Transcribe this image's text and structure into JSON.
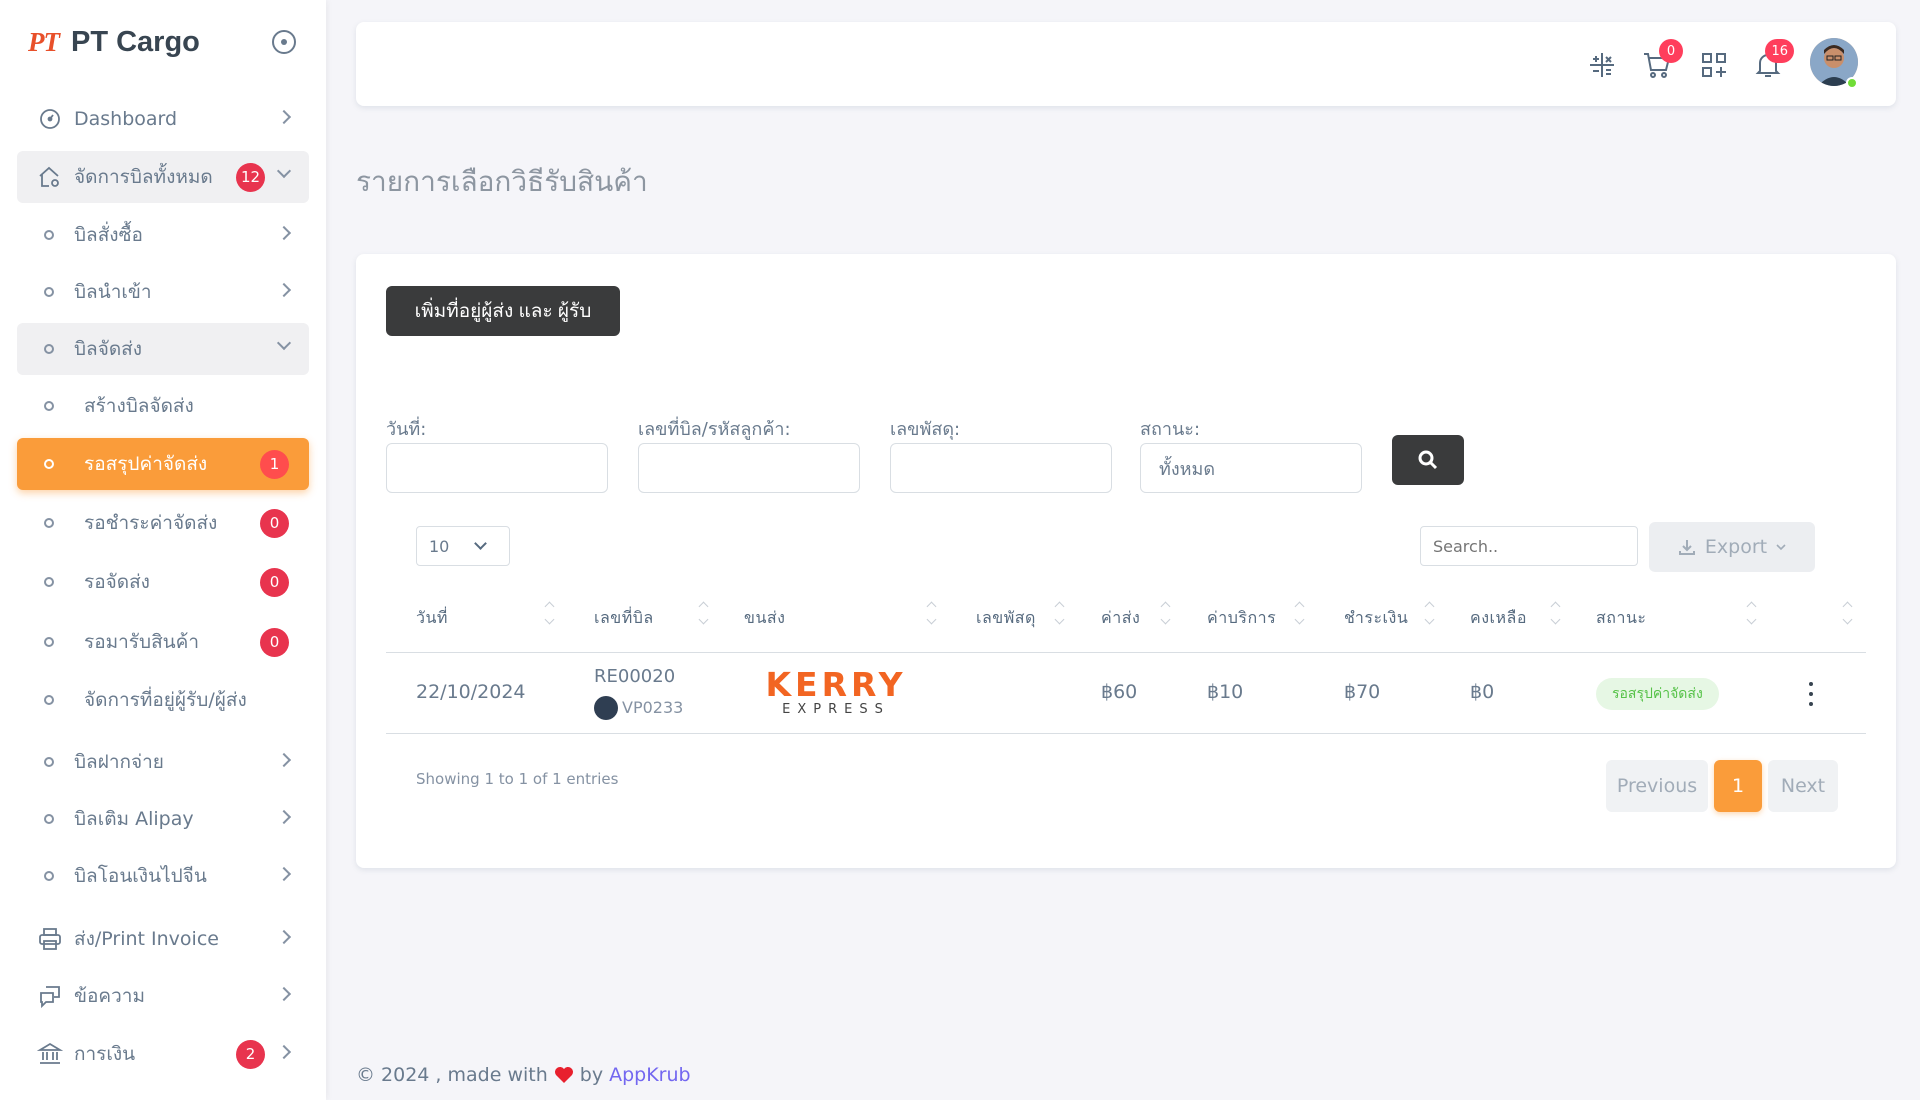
{
  "brand": {
    "logo": "PT",
    "name": "PT Cargo"
  },
  "sidebar": {
    "items": [
      {
        "label": "Dashboard"
      },
      {
        "label": "จัดการบิลทั้งหมด",
        "badge": "12"
      },
      {
        "label": "บิลสั่งซื้อ"
      },
      {
        "label": "บิลนำเข้า"
      },
      {
        "label": "บิลจัดส่ง"
      },
      {
        "label": "สร้างบิลจัดส่ง"
      },
      {
        "label": "รอสรุปค่าจัดส่ง",
        "badge": "1"
      },
      {
        "label": "รอชำระค่าจัดส่ง",
        "badge": "0"
      },
      {
        "label": "รอจัดส่ง",
        "badge": "0"
      },
      {
        "label": "รอมารับสินค้า",
        "badge": "0"
      },
      {
        "label": "จัดการที่อยู่ผู้รับ/ผู้ส่ง"
      },
      {
        "label": "บิลฝากจ่าย"
      },
      {
        "label": "บิลเติม Alipay"
      },
      {
        "label": "บิลโอนเงินไปจีน"
      },
      {
        "label": "ส่ง/Print Invoice"
      },
      {
        "label": "ข้อความ"
      },
      {
        "label": "การเงิน",
        "badge": "2"
      }
    ]
  },
  "topbar": {
    "cart_count": "0",
    "notification_count": "16"
  },
  "page": {
    "title": "รายการเลือกวิธีรับสินค้า"
  },
  "card": {
    "add_button": "เพิ่มที่อยู่ผู้ส่ง และ ผู้รับ",
    "filters": {
      "date_label": "วันที่:",
      "bill_label": "เลขที่บิล/รหัสลูกค้า:",
      "parcel_label": "เลขพัสดุ:",
      "status_label": "สถานะ:",
      "status_value": "ทั้งหมด"
    },
    "page_length": "10",
    "search_placeholder": "Search..",
    "export_label": "Export"
  },
  "table": {
    "columns": [
      "วันที่",
      "เลขที่บิล",
      "ขนส่ง",
      "เลขพัสดุ",
      "ค่าส่ง",
      "ค่าบริการ",
      "ชำระเงิน",
      "คงเหลือ",
      "สถานะ"
    ],
    "rows": [
      {
        "date": "22/10/2024",
        "bill_no": "RE00020",
        "customer": "VP0233",
        "carrier_logo": "KERRY",
        "carrier_sub": "EXPRESS",
        "parcel_no": "",
        "shipping": "฿60",
        "service": "฿10",
        "paid": "฿70",
        "balance": "฿0",
        "status": "รอสรุปค่าจัดส่ง"
      }
    ]
  },
  "pagination": {
    "info": "Showing 1 to 1 of 1 entries",
    "previous": "Previous",
    "current": "1",
    "next": "Next"
  },
  "footer": {
    "text": "© 2024 , made with",
    "by": "by",
    "link": "AppKrub"
  },
  "colors": {
    "accent": "#fa9c3a",
    "danger": "#e8344e",
    "dark_button": "#3a3b3c",
    "kerry": "#f26522"
  },
  "icons": [
    "radio-circle-icon",
    "dashboard-icon",
    "home-gear-icon",
    "printer-icon",
    "chat-icon",
    "bank-icon",
    "calculator-icon",
    "cart-icon",
    "grid-add-icon",
    "bell-icon",
    "search-icon",
    "download-icon"
  ]
}
